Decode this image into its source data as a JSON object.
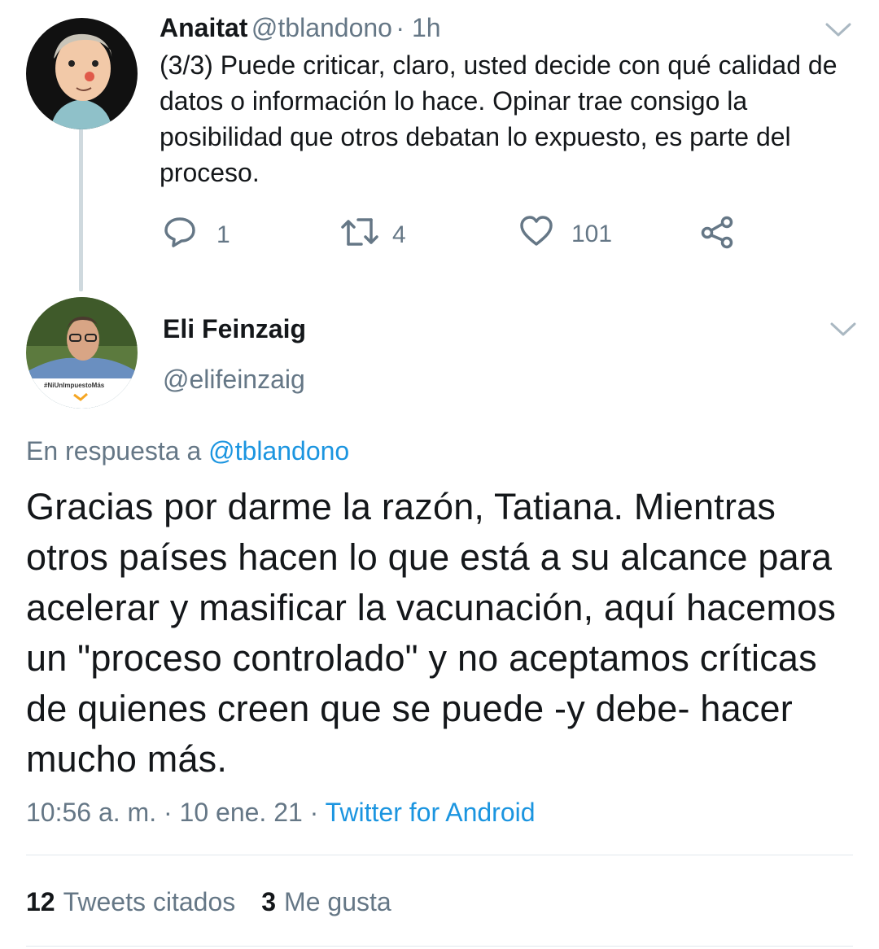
{
  "reply_tweet": {
    "display_name": "Anaitat",
    "handle": "@tblandono",
    "time": "· 1h",
    "text": "(3/3) Puede criticar, claro, usted decide con qué calidad de datos o información lo hace. Opinar trae consigo la posibilidad que otros debatan lo expuesto, es parte del proceso.",
    "replies": "1",
    "retweets": "4",
    "likes": "101"
  },
  "main_tweet": {
    "display_name": "Eli Feinzaig",
    "handle": "@elifeinzaig",
    "avatar_badge": "#NiUnImpuestoMás",
    "in_reply_prefix": "En respuesta a",
    "in_reply_handle": "@tblandono",
    "text": "Gracias por darme la razón, Tatiana. Mientras otros países hacen lo que está a su alcance para acelerar y masificar la vacunación, aquí hacemos un \"proceso controlado\" y no aceptamos críticas de quienes creen que se puede -y debe- hacer mucho más.",
    "timestamp": "10:56 a. m. · 10 ene. 21 ·",
    "source": "Twitter for Android"
  },
  "stats": {
    "quote_count": "12",
    "quote_label": "Tweets citados",
    "like_count": "3",
    "like_label": "Me gusta"
  },
  "icons": {
    "reply": "reply-icon",
    "retweet": "retweet-icon",
    "like": "heart-icon",
    "share": "share-icon",
    "menu": "chevron-down-icon"
  },
  "colors": {
    "link": "#1b95e0",
    "secondary_text": "#657786",
    "thread_line": "#cfd9de"
  }
}
